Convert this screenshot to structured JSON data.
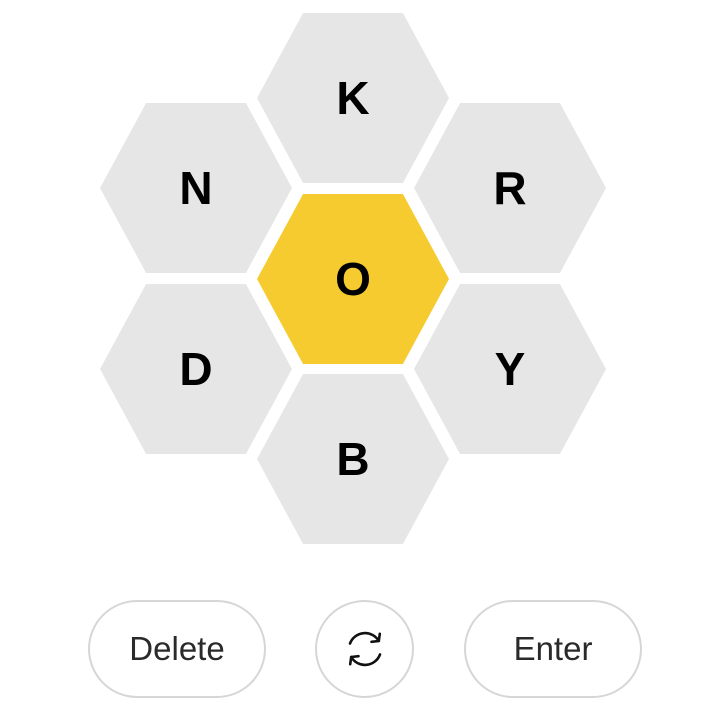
{
  "hive": {
    "center_letter": "O",
    "outer_letters": {
      "top": "K",
      "upper_left": "N",
      "upper_right": "R",
      "lower_left": "D",
      "lower_right": "Y",
      "bottom": "B"
    },
    "colors": {
      "center": "#f5cb30",
      "outer": "#e6e6e6"
    }
  },
  "controls": {
    "delete_label": "Delete",
    "shuffle_icon": "shuffle-icon",
    "enter_label": "Enter"
  }
}
